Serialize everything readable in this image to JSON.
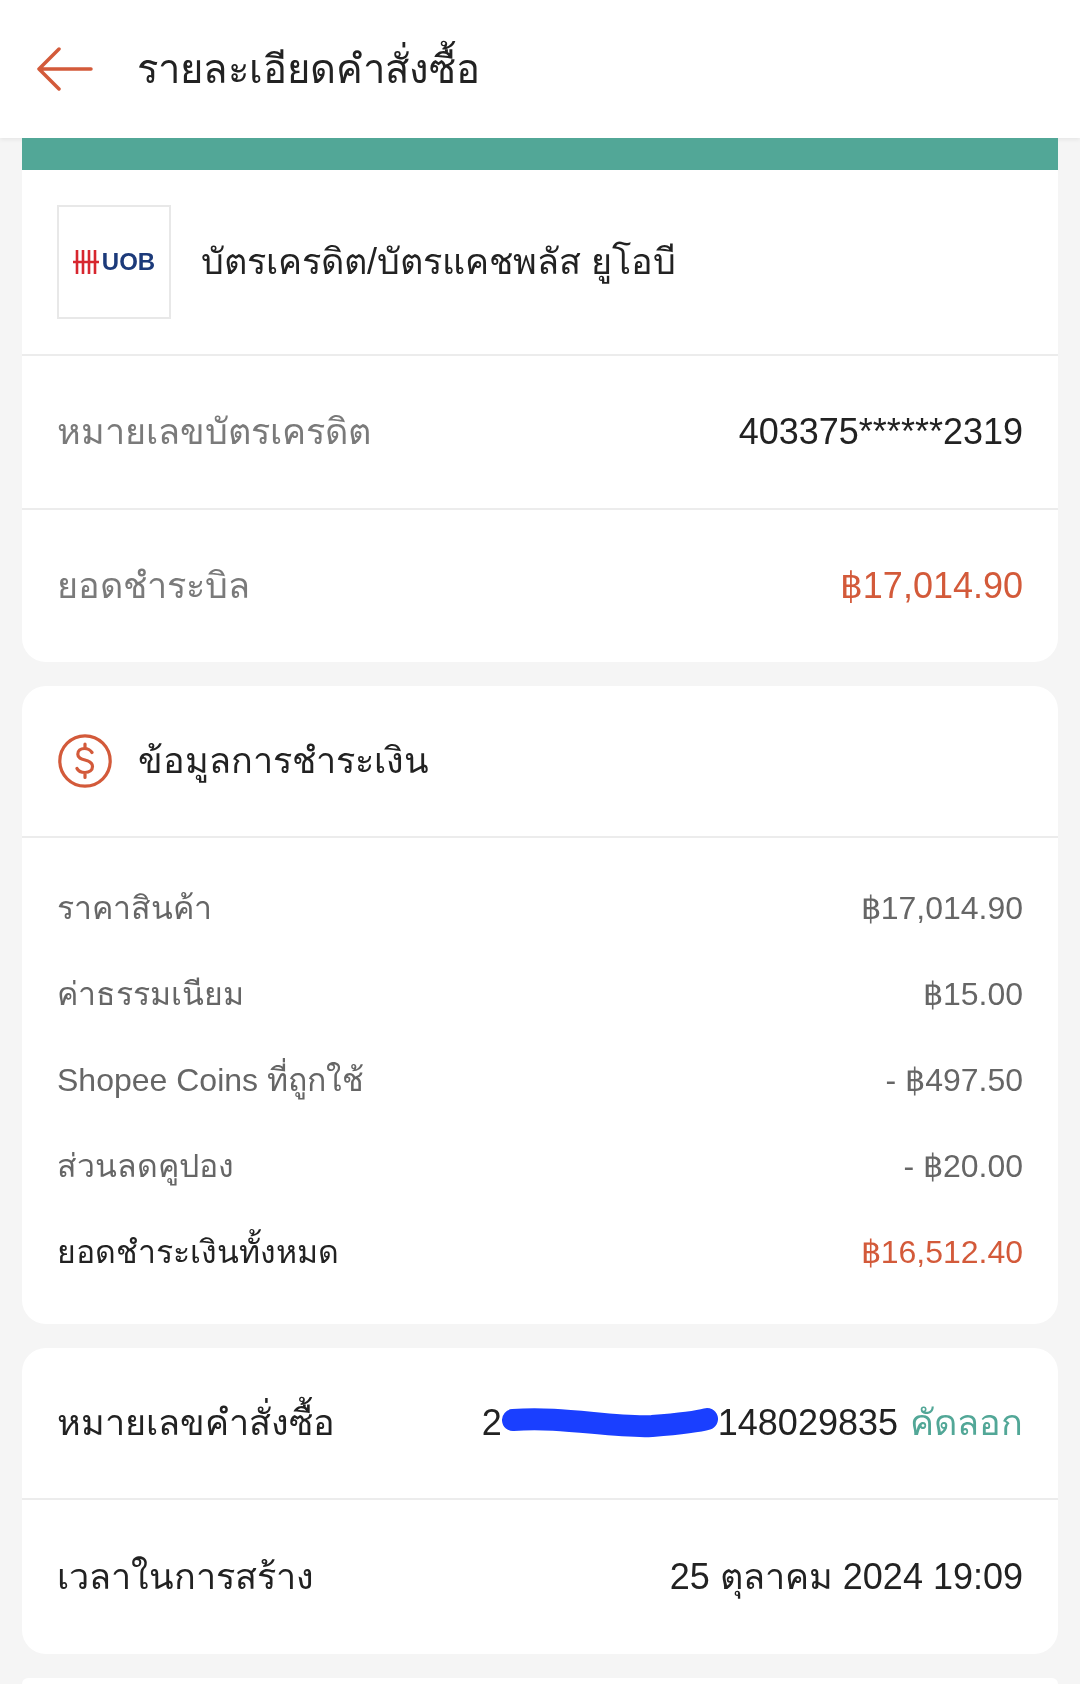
{
  "header": {
    "title": "รายละเอียดคำสั่งซื้อ"
  },
  "payment_method": {
    "name": "บัตรเครดิต/บัตรแคชพลัส ยูโอบี",
    "logo_text": "UOB",
    "rows": [
      {
        "label": "หมายเลขบัตรเครดิต",
        "value": "403375******2319",
        "kind": "plain"
      },
      {
        "label": "ยอดชำระบิล",
        "value": "฿17,014.90",
        "kind": "highlight"
      }
    ]
  },
  "payment_info": {
    "title": "ข้อมูลการชำระเงิน",
    "rows": [
      {
        "label": "ราคาสินค้า",
        "value": "฿17,014.90",
        "kind": "item"
      },
      {
        "label": "ค่าธรรมเนียม",
        "value": "฿15.00",
        "kind": "item"
      },
      {
        "label": "Shopee Coins ที่ถูกใช้",
        "value": "- ฿497.50",
        "kind": "item"
      },
      {
        "label": "ส่วนลดคูปอง",
        "value": "- ฿20.00",
        "kind": "item"
      },
      {
        "label": "ยอดชำระเงินทั้งหมด",
        "value": "฿16,512.40",
        "kind": "total"
      }
    ]
  },
  "order": {
    "number_label": "หมายเลขคำสั่งซื้อ",
    "number_start": "2",
    "number_end": "148029835",
    "copy_link": "คัดลอก",
    "created_label": "เวลาในการสร้าง",
    "created_value": "25 ตุลาคม 2024 19:09"
  }
}
